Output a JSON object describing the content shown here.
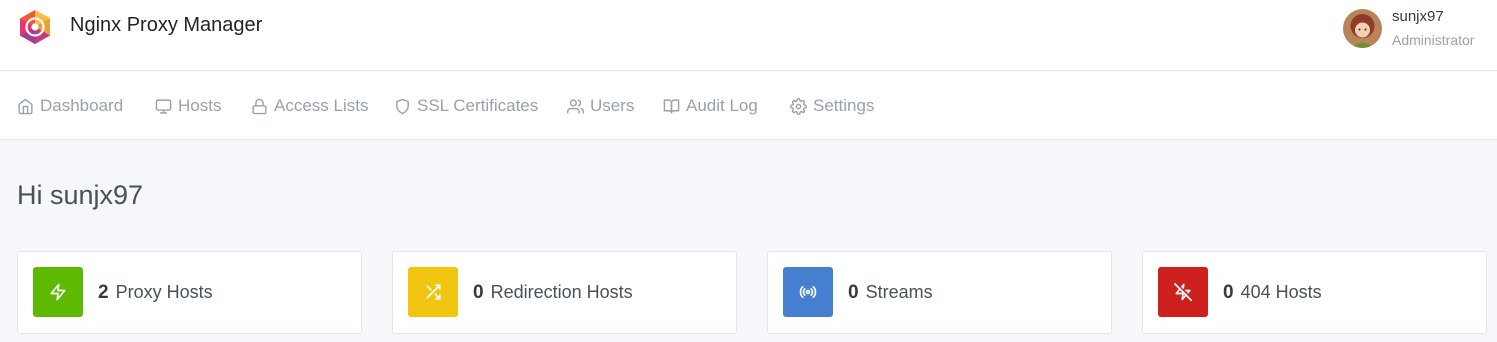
{
  "app": {
    "title": "Nginx Proxy Manager"
  },
  "user": {
    "name": "sunjx97",
    "role": "Administrator"
  },
  "nav": {
    "items": [
      {
        "label": "Dashboard",
        "icon": "home-icon"
      },
      {
        "label": "Hosts",
        "icon": "monitor-icon"
      },
      {
        "label": "Access Lists",
        "icon": "lock-icon"
      },
      {
        "label": "SSL Certificates",
        "icon": "shield-icon"
      },
      {
        "label": "Users",
        "icon": "users-icon"
      },
      {
        "label": "Audit Log",
        "icon": "book-open-icon"
      },
      {
        "label": "Settings",
        "icon": "settings-icon"
      }
    ]
  },
  "greeting": "Hi sunjx97",
  "stats": [
    {
      "count": "2",
      "label": "Proxy Hosts",
      "icon": "zap-icon",
      "color": "#5eba00"
    },
    {
      "count": "0",
      "label": "Redirection Hosts",
      "icon": "shuffle-icon",
      "color": "#f1c40f"
    },
    {
      "count": "0",
      "label": "Streams",
      "icon": "radio-icon",
      "color": "#467fcf"
    },
    {
      "count": "0",
      "label": "404 Hosts",
      "icon": "zap-off-icon",
      "color": "#cd201f"
    }
  ]
}
